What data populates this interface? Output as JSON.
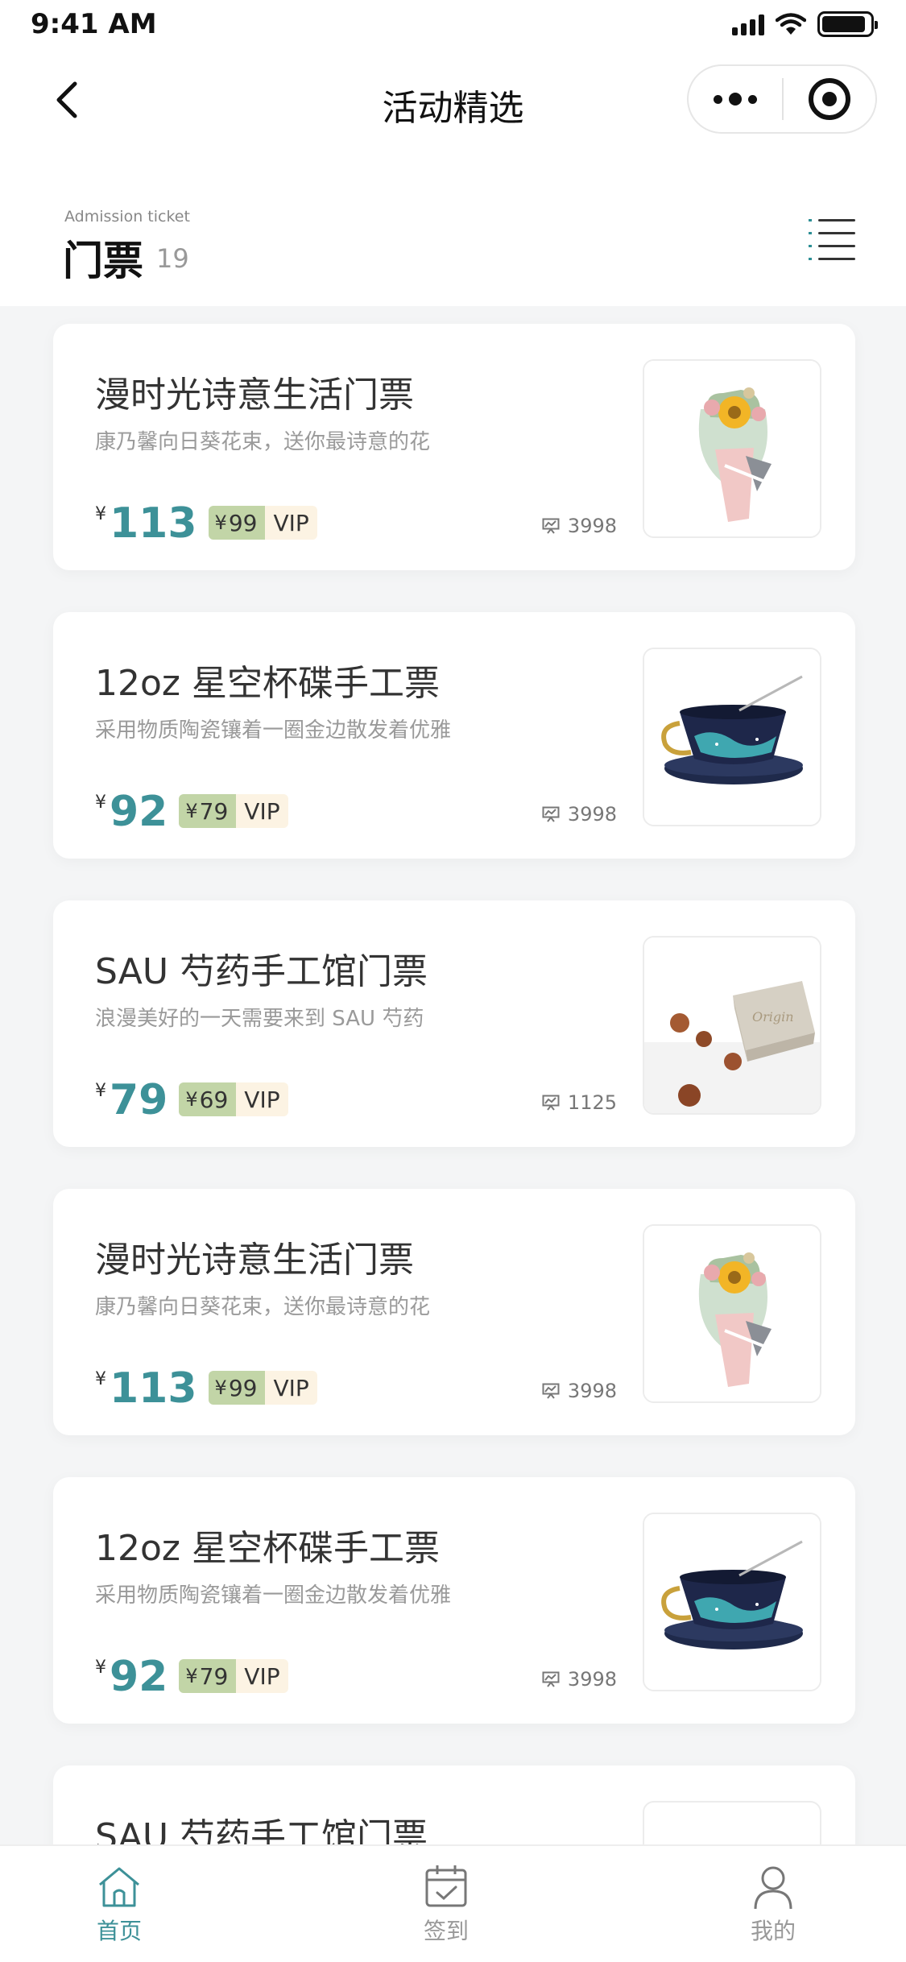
{
  "status_bar": {
    "time": "9:41 AM",
    "battery_level": 0.92
  },
  "nav": {
    "title": "活动精选"
  },
  "section": {
    "subtitle": "Admission ticket",
    "title": "门票",
    "count": "19"
  },
  "currency": "¥",
  "vip_label": "VIP",
  "cards": [
    {
      "title": "漫时光诗意生活门票",
      "desc": "康乃馨向日葵花束，送你最诗意的花",
      "price": "113",
      "vip_price": "99",
      "sales": "3998",
      "image": "flower-bouquet"
    },
    {
      "title": "12oz 星空杯碟手工票",
      "desc": "采用物质陶瓷镶着一圈金边散发着优雅",
      "price": "92",
      "vip_price": "79",
      "sales": "3998",
      "image": "starry-cup"
    },
    {
      "title": "SAU 芍药手工馆门票",
      "desc": "浪漫美好的一天需要来到 SAU 芍药",
      "price": "79",
      "vip_price": "69",
      "sales": "1125",
      "image": "handmade-soap"
    },
    {
      "title": "漫时光诗意生活门票",
      "desc": "康乃馨向日葵花束，送你最诗意的花",
      "price": "113",
      "vip_price": "99",
      "sales": "3998",
      "image": "flower-bouquet"
    },
    {
      "title": "12oz 星空杯碟手工票",
      "desc": "采用物质陶瓷镶着一圈金边散发着优雅",
      "price": "92",
      "vip_price": "79",
      "sales": "3998",
      "image": "starry-cup"
    },
    {
      "title": "SAU 芍药手工馆门票",
      "desc": "",
      "price": "",
      "vip_price": "",
      "sales": "",
      "image": ""
    }
  ],
  "tabs": [
    {
      "label": "首页",
      "icon": "home-icon",
      "active": true
    },
    {
      "label": "签到",
      "icon": "calendar-check-icon",
      "active": false
    },
    {
      "label": "我的",
      "icon": "user-icon",
      "active": false
    }
  ],
  "colors": {
    "accent": "#3d9198",
    "vip_green": "#c2d5a7",
    "vip_cream": "#fcf3e3",
    "background": "#f4f5f6"
  }
}
